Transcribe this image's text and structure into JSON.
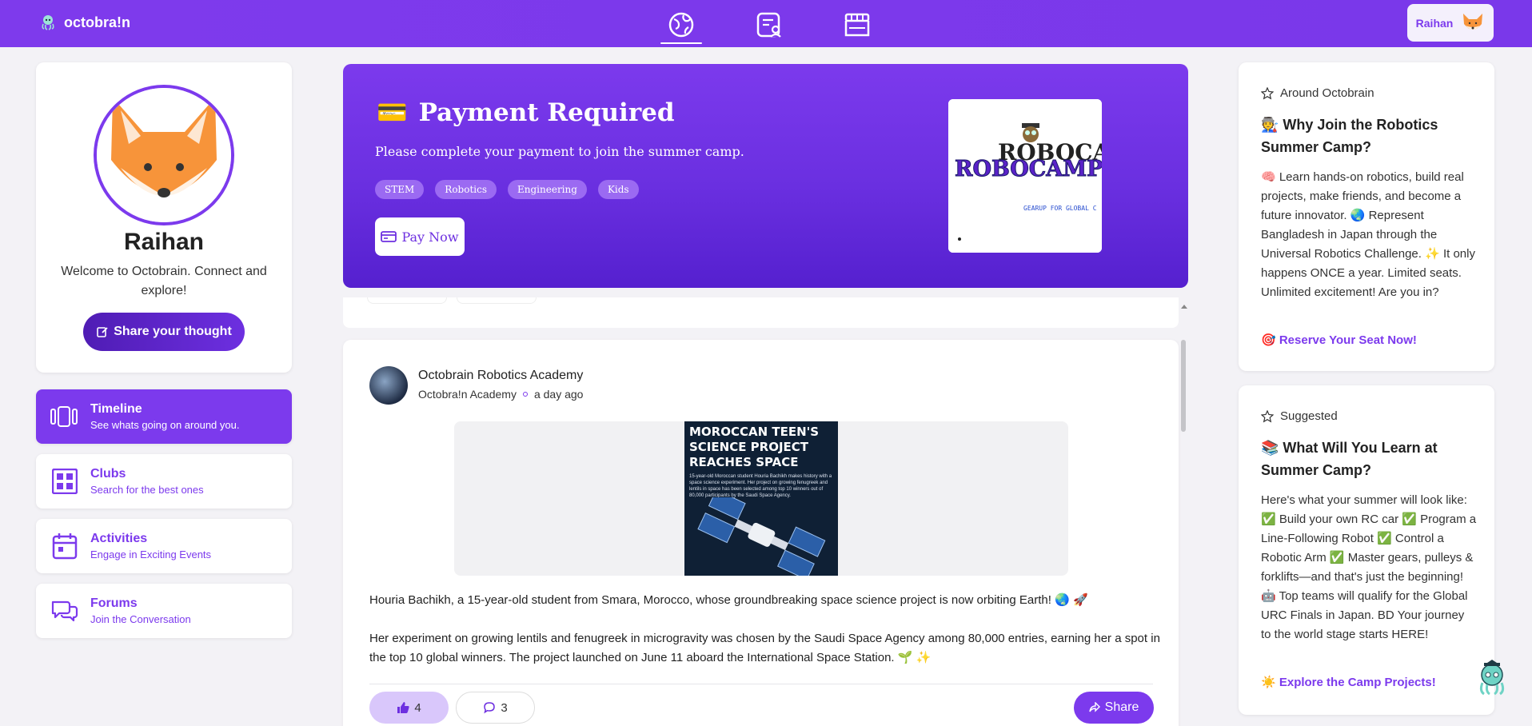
{
  "app": {
    "brand": "octobra!n",
    "user_name": "Raihan"
  },
  "topnav": {
    "icons": [
      "globe-icon",
      "profile-doc-icon",
      "store-icon"
    ]
  },
  "profile": {
    "name": "Raihan",
    "welcome": "Welcome to Octobrain. Connect and explore!",
    "share_label": "Share your thought"
  },
  "sidebar": {
    "items": [
      {
        "title": "Timeline",
        "subtitle": "See whats going on around you.",
        "icon": "timeline-icon"
      },
      {
        "title": "Clubs",
        "subtitle": "Search for the best ones",
        "icon": "grid-icon"
      },
      {
        "title": "Activities",
        "subtitle": "Engage in Exciting Events",
        "icon": "calendar-icon"
      },
      {
        "title": "Forums",
        "subtitle": "Join the Conversation",
        "icon": "chat-icon"
      }
    ]
  },
  "banner": {
    "emoji": "💳",
    "title": "Payment Required",
    "description": "Please complete your payment to join the summer camp.",
    "tags": [
      "STEM",
      "Robotics",
      "Engineering",
      "Kids"
    ],
    "pay_label": "Pay Now",
    "image_title": "ROBOCAMP",
    "image_sub": "GEARUP FOR GLOBAL C"
  },
  "post": {
    "author": "Octobrain Robotics Academy",
    "source": "Octobra!n Academy",
    "time": "a day ago",
    "image_headline": "MOROCCAN TEEN'S SCIENCE PROJECT REACHES SPACE",
    "image_body": "15-year-old Moroccan student Houria Bachikh makes history with a space science experiment. Her project on growing fenugreek and lentils in space has been selected among top 10 winners out of 80,000 participants by the Saudi Space Agency.",
    "paragraph_1": "Houria Bachikh, a 15-year-old student from Smara, Morocco, whose groundbreaking space science project is now orbiting Earth! 🌏 🚀",
    "paragraph_2": "Her experiment on growing lentils and fenugreek in microgravity was chosen by the Saudi Space Agency among 80,000 entries, earning her a spot in the top 10 global winners. The project launched on June 11 aboard the International Space Station. 🌱 ✨",
    "likes": "4",
    "comments": "3",
    "share_label": "Share"
  },
  "around": {
    "label": "Around Octobrain",
    "title": "🧑‍🏭 Why Join the Robotics Summer Camp?",
    "body": "🧠 Learn hands-on robotics, build real projects, make friends, and become a future innovator. 🌏 Represent Bangladesh in Japan through the Universal Robotics Challenge. ✨ It only happens ONCE a year. Limited seats. Unlimited excitement! Are you in?",
    "link": "🎯 Reserve Your Seat Now!"
  },
  "suggested": {
    "label": "Suggested",
    "title": "📚 What Will You Learn at Summer Camp?",
    "body": "Here's what your summer will look like: ✅ Build your own RC car ✅ Program a Line-Following Robot ✅ Control a Robotic Arm ✅ Master gears, pulleys & forklifts—and that's just the beginning! 🤖 Top teams will qualify for the Global URC Finals in Japan. BD Your journey to the world stage starts HERE!",
    "link": "☀️ Explore the Camp Projects!"
  },
  "colors": {
    "accent": "#7c3aed",
    "accent_dark": "#5520cf",
    "background": "#f3f2f6"
  }
}
